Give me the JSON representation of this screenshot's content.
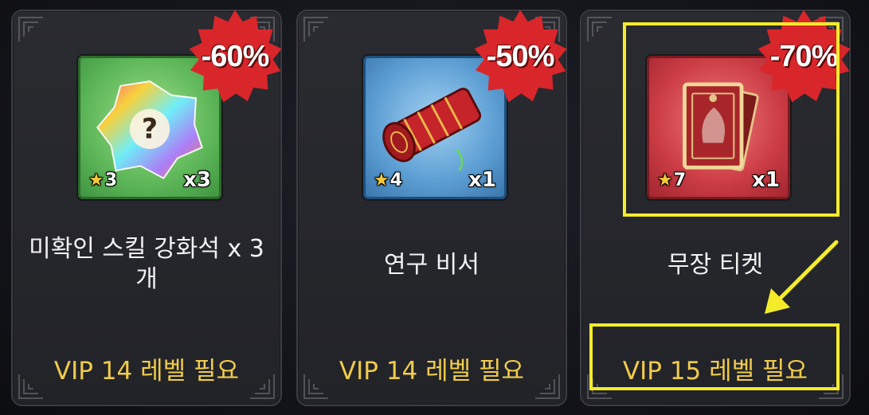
{
  "cards": [
    {
      "name": "미확인 스킬 강화석 x 3개",
      "discount": "-60%",
      "stars": "3",
      "quantity": "x3",
      "requirement": "VIP 14 레벨 필요",
      "rarity_color": "#5fb85a",
      "icon": "gem-flower-icon"
    },
    {
      "name": "연구 비서",
      "discount": "-50%",
      "stars": "4",
      "quantity": "x1",
      "requirement": "VIP 14 레벨 필요",
      "rarity_color": "#5c9ed3",
      "icon": "scroll-icon"
    },
    {
      "name": "무장 티켓",
      "discount": "-70%",
      "stars": "7",
      "quantity": "x1",
      "requirement": "VIP 15 레벨 필요",
      "rarity_color": "#cc3d45",
      "icon": "ticket-card-icon"
    }
  ],
  "colors": {
    "requirement_text": "#f0cb4c",
    "highlight": "#f4ec2a",
    "discount_badge": "#d9262b"
  }
}
